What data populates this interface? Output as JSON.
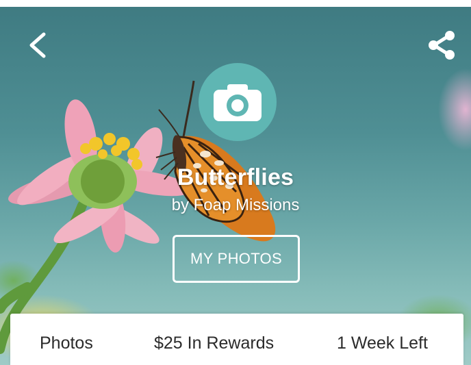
{
  "header": {
    "back_icon": "chevron-left-icon",
    "share_icon": "share-icon"
  },
  "mission": {
    "logo_icon": "camera-icon",
    "title": "Butterflies",
    "byline": "by Foap Missions",
    "my_photos_label": "MY PHOTOS"
  },
  "stats": {
    "photos_label": "Photos",
    "rewards_label": "$25 In Rewards",
    "time_left_label": "1 Week Left"
  },
  "colors": {
    "logo_bg": "#5fb6b3",
    "sky": "#4f8f94",
    "card_bg": "#ffffff",
    "text_dark": "#2b2b2b"
  }
}
